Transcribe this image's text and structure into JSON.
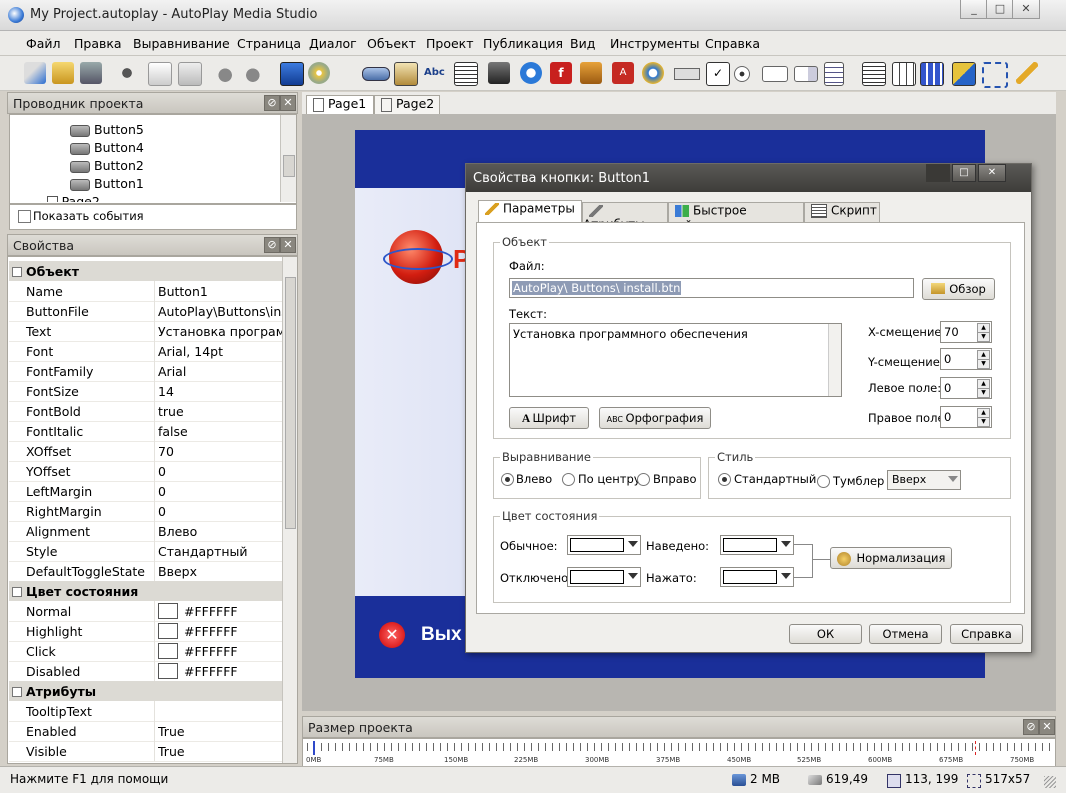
{
  "window": {
    "title": "My Project.autoplay - AutoPlay Media Studio"
  },
  "menu": [
    "Файл",
    "Правка",
    "Выравнивание",
    "Страница",
    "Диалог",
    "Объект",
    "Проект",
    "Публикация",
    "Вид",
    "Инструменты",
    "Справка"
  ],
  "explorer": {
    "title": "Проводник проекта",
    "items": [
      "Button5",
      "Button4",
      "Button2",
      "Button1",
      "Page2"
    ],
    "show_events": "Показать события"
  },
  "props": {
    "title": "Свойства",
    "cat_object": "Объект",
    "rows": [
      {
        "name": "Name",
        "value": "Button1"
      },
      {
        "name": "ButtonFile",
        "value": "AutoPlay\\Buttons\\inst"
      },
      {
        "name": "Text",
        "value": "Установка программн"
      },
      {
        "name": "Font",
        "value": "Arial, 14pt"
      },
      {
        "name": "FontFamily",
        "value": "Arial"
      },
      {
        "name": "FontSize",
        "value": "14"
      },
      {
        "name": "FontBold",
        "value": "true"
      },
      {
        "name": "FontItalic",
        "value": "false"
      },
      {
        "name": "XOffset",
        "value": "70"
      },
      {
        "name": "YOffset",
        "value": "0"
      },
      {
        "name": "LeftMargin",
        "value": "0"
      },
      {
        "name": "RightMargin",
        "value": "0"
      },
      {
        "name": "Alignment",
        "value": "Влево"
      },
      {
        "name": "Style",
        "value": "Стандартный"
      },
      {
        "name": "DefaultToggleState",
        "value": "Вверх"
      }
    ],
    "cat_colors": "Цвет состояния",
    "colors": [
      {
        "name": "Normal",
        "value": "#FFFFFF"
      },
      {
        "name": "Highlight",
        "value": "#FFFFFF"
      },
      {
        "name": "Click",
        "value": "#FFFFFF"
      },
      {
        "name": "Disabled",
        "value": "#FFFFFF"
      }
    ],
    "cat_attrs": "Атрибуты",
    "attrs": [
      {
        "name": "TooltipText",
        "value": ""
      },
      {
        "name": "Enabled",
        "value": "True"
      },
      {
        "name": "Visible",
        "value": "True"
      }
    ]
  },
  "pages": [
    "Page1",
    "Page2"
  ],
  "canvas": {
    "letter": "P",
    "exit_text": "Вых"
  },
  "dialog": {
    "title": "Свойства кнопки: Button1",
    "tabs": [
      "Параметры",
      "Атрибуты",
      "Быстрое действие",
      "Скрипт"
    ],
    "group_object": "Объект",
    "file_label": "Файл:",
    "file_value": "AutoPlay\\ Buttons\\ install.btn",
    "browse": "Обзор",
    "text_label": "Текст:",
    "text_value": "Установка программного обеспечения",
    "xoffset_label": "X-смещение:",
    "xoffset": "70",
    "yoffset_label": "Y-смещение:",
    "yoffset": "0",
    "left_margin_label": "Левое поле:",
    "left_margin": "0",
    "right_margin_label": "Правое поле:",
    "right_margin": "0",
    "font_btn": "Шрифт",
    "spell_btn": "Орфография",
    "group_align": "Выравнивание",
    "align_left": "Влево",
    "align_center": "По центру",
    "align_right": "Вправо",
    "group_style": "Стиль",
    "style_standard": "Стандартный",
    "style_toggle": "Тумблер",
    "toggle_value": "Вверх",
    "group_state": "Цвет состояния",
    "normal": "Обычное:",
    "hover": "Наведено:",
    "disabled": "Отключено:",
    "pressed": "Нажато:",
    "normalize": "Нормализация",
    "ok": "ОК",
    "cancel": "Отмена",
    "help": "Справка"
  },
  "sizebar": {
    "title": "Размер проекта",
    "ticks": [
      "0MB",
      "75MB",
      "150MB",
      "225MB",
      "300MB",
      "375MB",
      "450MB",
      "525MB",
      "600MB",
      "675MB",
      "750MB"
    ]
  },
  "status": {
    "hint": "Нажмите F1 для помощи",
    "size": "2 MB",
    "pos": "619,49",
    "coords": "113, 199",
    "dims": "517x57"
  }
}
